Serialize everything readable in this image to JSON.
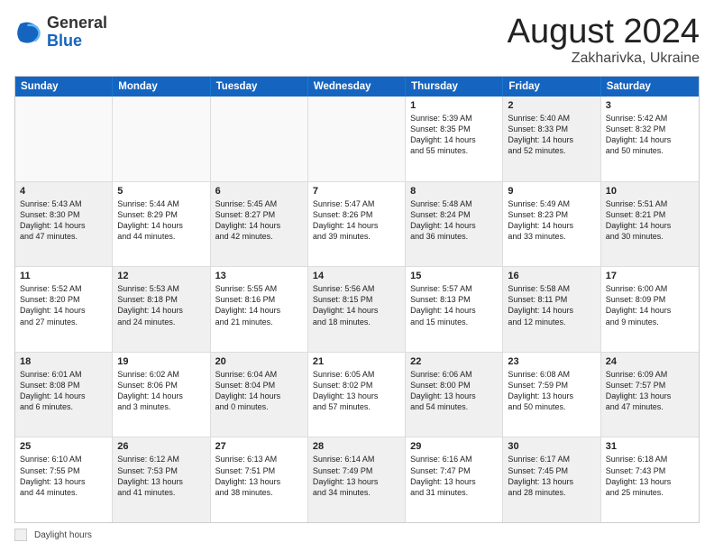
{
  "header": {
    "logo_general": "General",
    "logo_blue": "Blue",
    "title": "August 2024",
    "location": "Zakharivka, Ukraine"
  },
  "days": [
    "Sunday",
    "Monday",
    "Tuesday",
    "Wednesday",
    "Thursday",
    "Friday",
    "Saturday"
  ],
  "weeks": [
    [
      {
        "day": "",
        "text": "",
        "empty": true
      },
      {
        "day": "",
        "text": "",
        "empty": true
      },
      {
        "day": "",
        "text": "",
        "empty": true
      },
      {
        "day": "",
        "text": "",
        "empty": true
      },
      {
        "day": "1",
        "text": "Sunrise: 5:39 AM\nSunset: 8:35 PM\nDaylight: 14 hours\nand 55 minutes.",
        "empty": false
      },
      {
        "day": "2",
        "text": "Sunrise: 5:40 AM\nSunset: 8:33 PM\nDaylight: 14 hours\nand 52 minutes.",
        "empty": false,
        "shaded": true
      },
      {
        "day": "3",
        "text": "Sunrise: 5:42 AM\nSunset: 8:32 PM\nDaylight: 14 hours\nand 50 minutes.",
        "empty": false
      }
    ],
    [
      {
        "day": "4",
        "text": "Sunrise: 5:43 AM\nSunset: 8:30 PM\nDaylight: 14 hours\nand 47 minutes.",
        "empty": false,
        "shaded": true
      },
      {
        "day": "5",
        "text": "Sunrise: 5:44 AM\nSunset: 8:29 PM\nDaylight: 14 hours\nand 44 minutes.",
        "empty": false
      },
      {
        "day": "6",
        "text": "Sunrise: 5:45 AM\nSunset: 8:27 PM\nDaylight: 14 hours\nand 42 minutes.",
        "empty": false,
        "shaded": true
      },
      {
        "day": "7",
        "text": "Sunrise: 5:47 AM\nSunset: 8:26 PM\nDaylight: 14 hours\nand 39 minutes.",
        "empty": false
      },
      {
        "day": "8",
        "text": "Sunrise: 5:48 AM\nSunset: 8:24 PM\nDaylight: 14 hours\nand 36 minutes.",
        "empty": false,
        "shaded": true
      },
      {
        "day": "9",
        "text": "Sunrise: 5:49 AM\nSunset: 8:23 PM\nDaylight: 14 hours\nand 33 minutes.",
        "empty": false
      },
      {
        "day": "10",
        "text": "Sunrise: 5:51 AM\nSunset: 8:21 PM\nDaylight: 14 hours\nand 30 minutes.",
        "empty": false,
        "shaded": true
      }
    ],
    [
      {
        "day": "11",
        "text": "Sunrise: 5:52 AM\nSunset: 8:20 PM\nDaylight: 14 hours\nand 27 minutes.",
        "empty": false
      },
      {
        "day": "12",
        "text": "Sunrise: 5:53 AM\nSunset: 8:18 PM\nDaylight: 14 hours\nand 24 minutes.",
        "empty": false,
        "shaded": true
      },
      {
        "day": "13",
        "text": "Sunrise: 5:55 AM\nSunset: 8:16 PM\nDaylight: 14 hours\nand 21 minutes.",
        "empty": false
      },
      {
        "day": "14",
        "text": "Sunrise: 5:56 AM\nSunset: 8:15 PM\nDaylight: 14 hours\nand 18 minutes.",
        "empty": false,
        "shaded": true
      },
      {
        "day": "15",
        "text": "Sunrise: 5:57 AM\nSunset: 8:13 PM\nDaylight: 14 hours\nand 15 minutes.",
        "empty": false
      },
      {
        "day": "16",
        "text": "Sunrise: 5:58 AM\nSunset: 8:11 PM\nDaylight: 14 hours\nand 12 minutes.",
        "empty": false,
        "shaded": true
      },
      {
        "day": "17",
        "text": "Sunrise: 6:00 AM\nSunset: 8:09 PM\nDaylight: 14 hours\nand 9 minutes.",
        "empty": false
      }
    ],
    [
      {
        "day": "18",
        "text": "Sunrise: 6:01 AM\nSunset: 8:08 PM\nDaylight: 14 hours\nand 6 minutes.",
        "empty": false,
        "shaded": true
      },
      {
        "day": "19",
        "text": "Sunrise: 6:02 AM\nSunset: 8:06 PM\nDaylight: 14 hours\nand 3 minutes.",
        "empty": false
      },
      {
        "day": "20",
        "text": "Sunrise: 6:04 AM\nSunset: 8:04 PM\nDaylight: 14 hours\nand 0 minutes.",
        "empty": false,
        "shaded": true
      },
      {
        "day": "21",
        "text": "Sunrise: 6:05 AM\nSunset: 8:02 PM\nDaylight: 13 hours\nand 57 minutes.",
        "empty": false
      },
      {
        "day": "22",
        "text": "Sunrise: 6:06 AM\nSunset: 8:00 PM\nDaylight: 13 hours\nand 54 minutes.",
        "empty": false,
        "shaded": true
      },
      {
        "day": "23",
        "text": "Sunrise: 6:08 AM\nSunset: 7:59 PM\nDaylight: 13 hours\nand 50 minutes.",
        "empty": false
      },
      {
        "day": "24",
        "text": "Sunrise: 6:09 AM\nSunset: 7:57 PM\nDaylight: 13 hours\nand 47 minutes.",
        "empty": false,
        "shaded": true
      }
    ],
    [
      {
        "day": "25",
        "text": "Sunrise: 6:10 AM\nSunset: 7:55 PM\nDaylight: 13 hours\nand 44 minutes.",
        "empty": false
      },
      {
        "day": "26",
        "text": "Sunrise: 6:12 AM\nSunset: 7:53 PM\nDaylight: 13 hours\nand 41 minutes.",
        "empty": false,
        "shaded": true
      },
      {
        "day": "27",
        "text": "Sunrise: 6:13 AM\nSunset: 7:51 PM\nDaylight: 13 hours\nand 38 minutes.",
        "empty": false
      },
      {
        "day": "28",
        "text": "Sunrise: 6:14 AM\nSunset: 7:49 PM\nDaylight: 13 hours\nand 34 minutes.",
        "empty": false,
        "shaded": true
      },
      {
        "day": "29",
        "text": "Sunrise: 6:16 AM\nSunset: 7:47 PM\nDaylight: 13 hours\nand 31 minutes.",
        "empty": false
      },
      {
        "day": "30",
        "text": "Sunrise: 6:17 AM\nSunset: 7:45 PM\nDaylight: 13 hours\nand 28 minutes.",
        "empty": false,
        "shaded": true
      },
      {
        "day": "31",
        "text": "Sunrise: 6:18 AM\nSunset: 7:43 PM\nDaylight: 13 hours\nand 25 minutes.",
        "empty": false
      }
    ]
  ],
  "legend": {
    "label": "Daylight hours"
  }
}
